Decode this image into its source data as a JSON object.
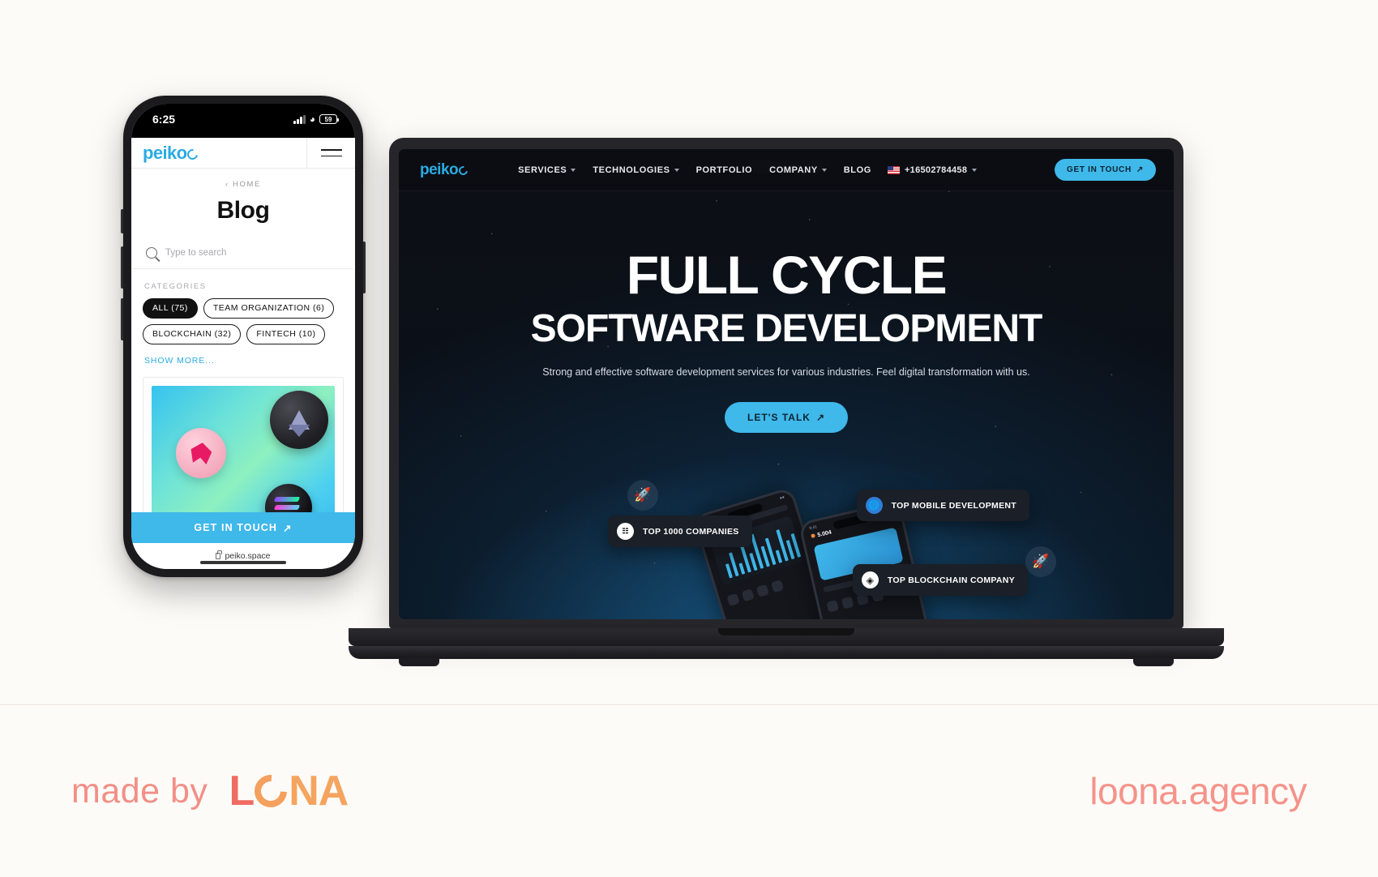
{
  "phone": {
    "status_bar": {
      "time": "6:25",
      "battery": "59",
      "signal_icon": "cellular-bars-icon",
      "wifi_icon": "wifi-icon"
    },
    "header": {
      "logo": "peiko",
      "menu_icon": "hamburger-menu-icon"
    },
    "breadcrumb": "‹ HOME",
    "page_title": "Blog",
    "search": {
      "placeholder": "Type to search",
      "icon": "search-icon"
    },
    "categories_label": "CATEGORIES",
    "chips": [
      {
        "label": "ALL (75)",
        "active": true
      },
      {
        "label": "TEAM ORGANIZATION (6)",
        "active": false
      },
      {
        "label": "BLOCKCHAIN (32)",
        "active": false
      },
      {
        "label": "FINTECH (10)",
        "active": false
      }
    ],
    "show_more": "SHOW MORE...",
    "cta": "GET IN TOUCH",
    "cta_icon": "arrow-up-right-icon",
    "url": "peiko.space",
    "url_icon": "lock-icon"
  },
  "laptop": {
    "nav": {
      "logo": "peiko",
      "items": [
        {
          "label": "SERVICES",
          "has_dropdown": true
        },
        {
          "label": "TECHNOLOGIES",
          "has_dropdown": true
        },
        {
          "label": "PORTFOLIO",
          "has_dropdown": false
        },
        {
          "label": "COMPANY",
          "has_dropdown": true
        },
        {
          "label": "BLOG",
          "has_dropdown": false
        }
      ],
      "phone_number": "+16502784458",
      "flag_icon": "us-flag-icon",
      "cta": "GET IN TOUCH",
      "cta_icon": "arrow-up-right-icon"
    },
    "hero": {
      "title_line1": "FULL CYCLE",
      "title_line2": "SOFTWARE DEVELOPMENT",
      "subtitle": "Strong and effective software development services for various industries. Feel digital transformation with us.",
      "cta": "LET'S TALK",
      "cta_icon": "arrow-up-right-icon"
    },
    "badges": [
      {
        "label": "TOP 1000 COMPANIES",
        "icon": "clutch-icon"
      },
      {
        "label": "TOP MOBILE DEVELOPMENT",
        "icon": "globe-icon"
      },
      {
        "label": "TOP BLOCKCHAIN COMPANY",
        "icon": "diamond-icon"
      }
    ],
    "floating_icons": [
      "rocket-icon",
      "rocket-icon"
    ],
    "mock_amount": "5.004"
  },
  "footer": {
    "made_by": "made by",
    "brand": {
      "part1": "L",
      "part2": "NA"
    },
    "website": "loona.agency"
  },
  "colors": {
    "accent_blue": "#3fb8ea",
    "brand_coral": "#f28f87",
    "brand_orange": "#f5a45f",
    "page_bg": "#fdfaf5"
  }
}
